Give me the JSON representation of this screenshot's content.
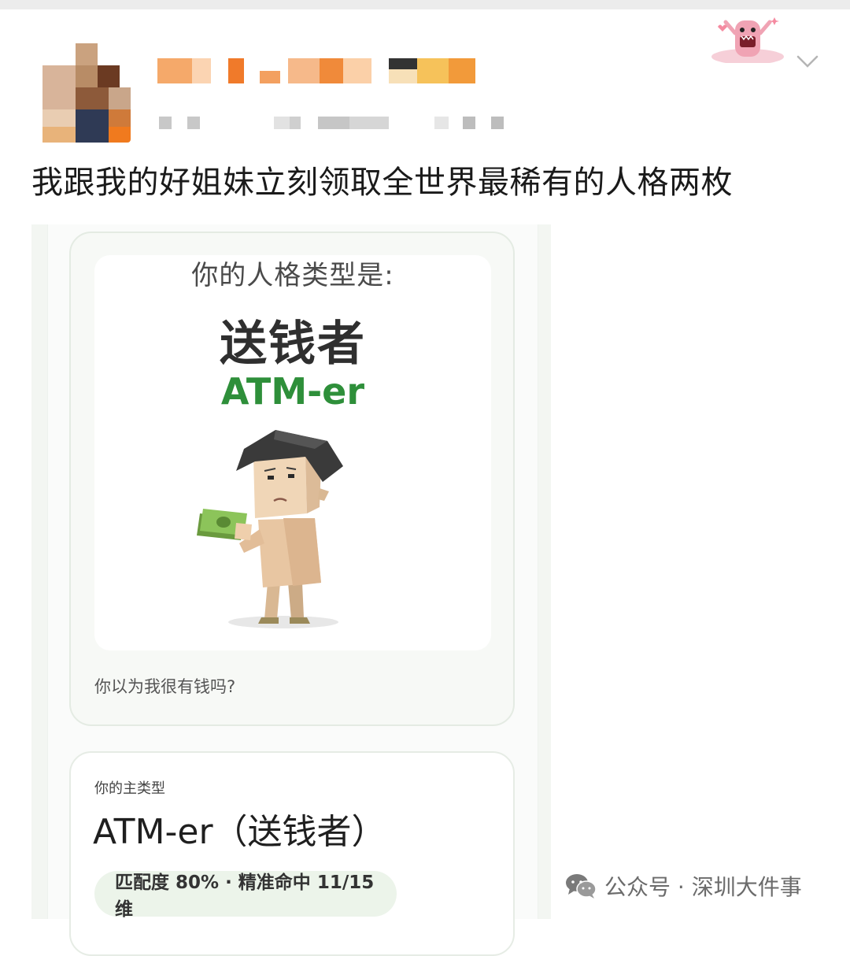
{
  "post": {
    "text": "我跟我的好姐妹立刻领取全世界最稀有的人格两枚"
  },
  "screenshot": {
    "question": "你的人格类型是:",
    "type_cn": "送钱者",
    "type_en": "ATM-er",
    "quote": "你以为我很有钱吗?",
    "main_type_label": "你的主类型",
    "main_type": "ATM-er（送钱者）",
    "match": "匹配度 80% · 精准命中 11/15 维"
  },
  "watermark": {
    "text": "公众号 · 深圳大件事"
  },
  "colors": {
    "accent_green": "#2e8f3a",
    "pill_bg": "#ecf4ea"
  },
  "icons": {
    "expand": "chevron-down-icon",
    "watermark": "wechat-icon"
  }
}
